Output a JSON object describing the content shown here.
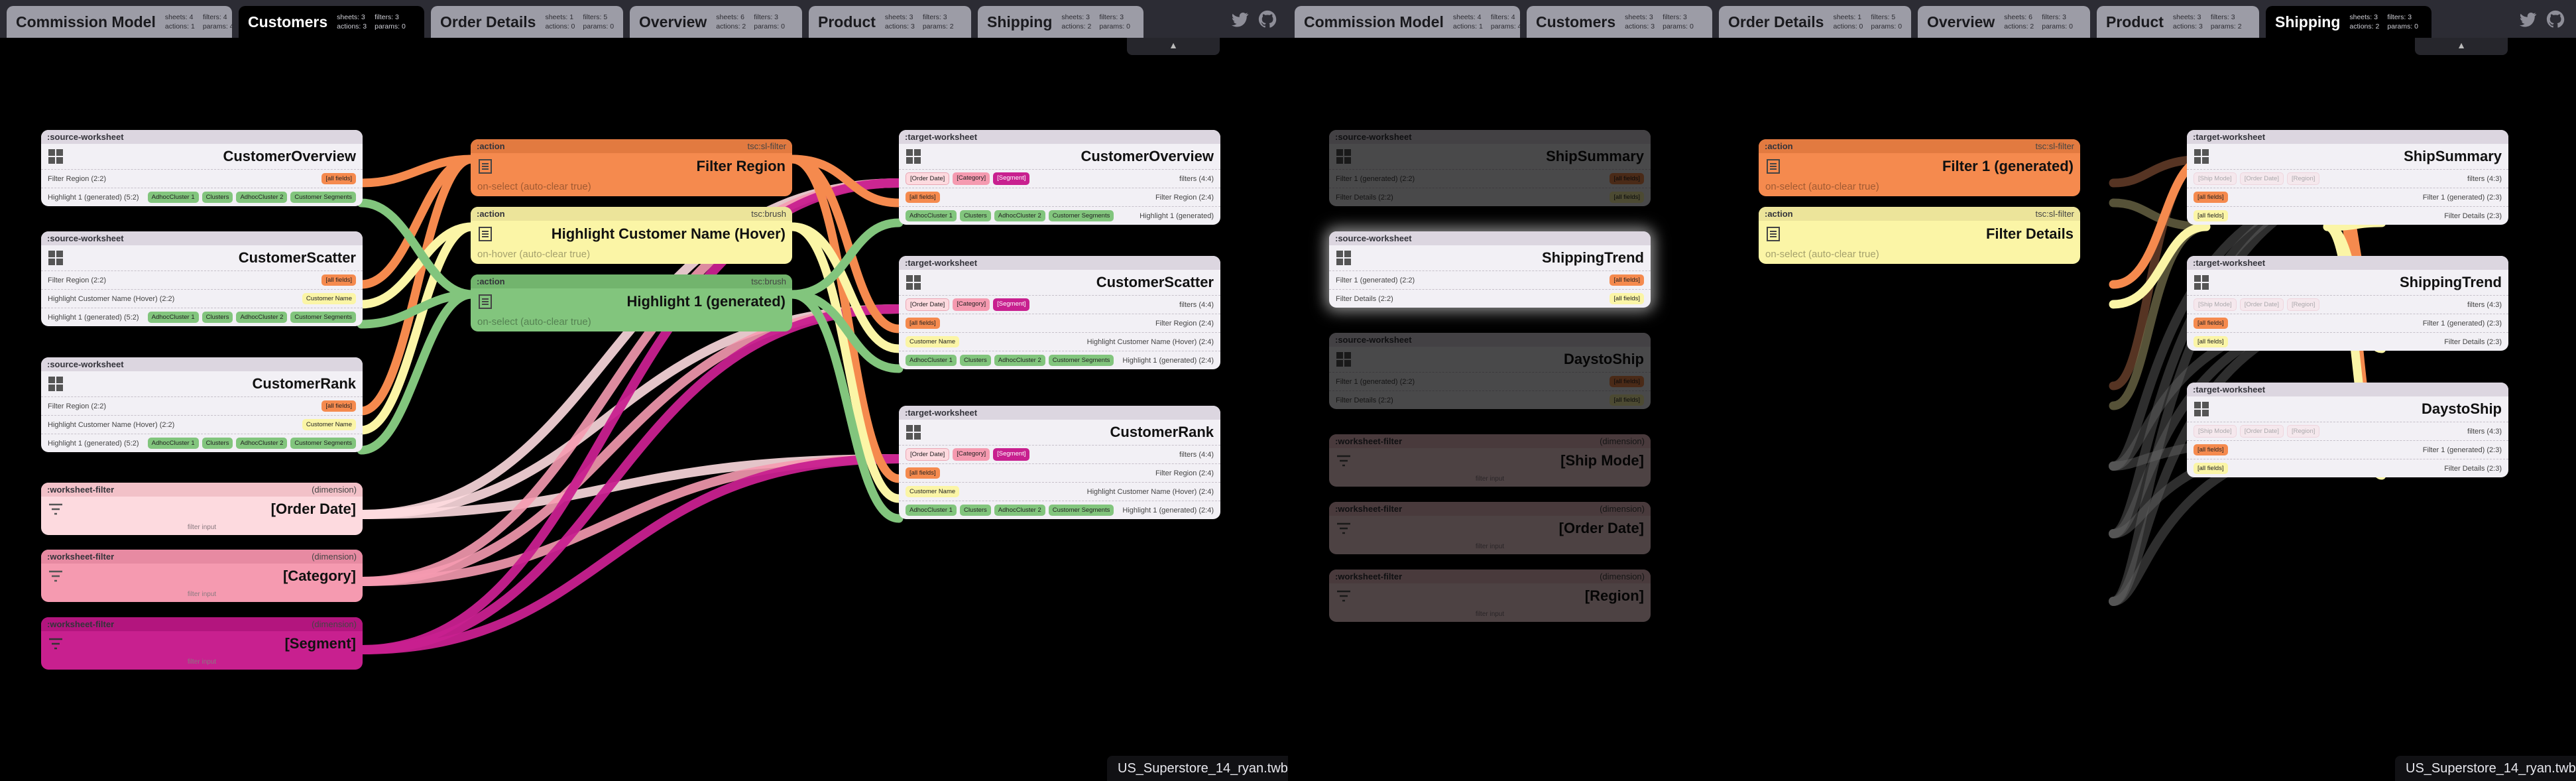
{
  "workbook": "US_Superstore_14_ryan.twb",
  "colors": {
    "orange": "#f58a4e",
    "yellow": "#fbf5a6",
    "green": "#82c57d",
    "pink": "#fddadf",
    "rose": "#f59ab0",
    "magenta": "#c8208f",
    "tabbar": "#2c2c34"
  },
  "icons": {
    "twitter": "twitter-icon",
    "github": "github-icon",
    "collapse": "caret-up-icon",
    "worksheet": "worksheet-grid-icon",
    "filter": "filter-lines-icon"
  },
  "tabs": [
    {
      "name": "Commission Model",
      "sheets": "sheets: 4",
      "filters": "filters: 4",
      "actions": "actions: 1",
      "params": "params: 4"
    },
    {
      "name": "Customers",
      "sheets": "sheets: 3",
      "filters": "filters: 3",
      "actions": "actions: 3",
      "params": "params: 0"
    },
    {
      "name": "Order Details",
      "sheets": "sheets: 1",
      "filters": "filters: 5",
      "actions": "actions: 0",
      "params": "params: 0"
    },
    {
      "name": "Overview",
      "sheets": "sheets: 6",
      "filters": "filters: 3",
      "actions": "actions: 2",
      "params": "params: 0"
    },
    {
      "name": "Product",
      "sheets": "sheets: 3",
      "filters": "filters: 3",
      "actions": "actions: 3",
      "params": "params: 2"
    },
    {
      "name": "Shipping",
      "sheets": "sheets: 3",
      "filters": "filters: 3",
      "actions": "actions: 2",
      "params": "params: 0"
    }
  ],
  "labels": {
    "source_ws": ":source-worksheet",
    "target_ws": ":target-worksheet",
    "action": ":action",
    "ws_filter": ":worksheet-filter",
    "dimension": "(dimension)",
    "filter_input": "filter input",
    "tsc_filter": "tsc:sl-filter",
    "tsc_brush": "tsc:brush",
    "all_fields": "[all fields]"
  },
  "left": {
    "sources": [
      {
        "title": "CustomerOverview",
        "rows": [
          {
            "name": "Filter Region (2:2)",
            "chips": [
              {
                "t": "[all fields]",
                "c": "orange"
              }
            ]
          },
          {
            "name": "Highlight 1 (generated) (5:2)",
            "chips": [
              {
                "t": "AdhocCluster 1",
                "c": "green"
              },
              {
                "t": "Clusters",
                "c": "green"
              },
              {
                "t": "AdhocCluster 2",
                "c": "green"
              },
              {
                "t": "Customer Segments",
                "c": "green"
              }
            ]
          }
        ]
      },
      {
        "title": "CustomerScatter",
        "rows": [
          {
            "name": "Filter Region (2:2)",
            "chips": [
              {
                "t": "[all fields]",
                "c": "orange"
              }
            ]
          },
          {
            "name": "Highlight Customer Name (Hover) (2:2)",
            "chips": [
              {
                "t": "Customer Name",
                "c": "yellow"
              }
            ]
          },
          {
            "name": "Highlight 1 (generated) (5:2)",
            "chips": [
              {
                "t": "AdhocCluster 1",
                "c": "green"
              },
              {
                "t": "Clusters",
                "c": "green"
              },
              {
                "t": "AdhocCluster 2",
                "c": "green"
              },
              {
                "t": "Customer Segments",
                "c": "green"
              }
            ]
          }
        ]
      },
      {
        "title": "CustomerRank",
        "rows": [
          {
            "name": "Filter Region (2:2)",
            "chips": [
              {
                "t": "[all fields]",
                "c": "orange"
              }
            ]
          },
          {
            "name": "Highlight Customer Name (Hover) (2:2)",
            "chips": [
              {
                "t": "Customer Name",
                "c": "yellow"
              }
            ]
          },
          {
            "name": "Highlight 1 (generated) (5:2)",
            "chips": [
              {
                "t": "AdhocCluster 1",
                "c": "green"
              },
              {
                "t": "Clusters",
                "c": "green"
              },
              {
                "t": "AdhocCluster 2",
                "c": "green"
              },
              {
                "t": "Customer Segments",
                "c": "green"
              }
            ]
          }
        ]
      }
    ],
    "filters": [
      {
        "title": "[Order Date]"
      },
      {
        "title": "[Category]"
      },
      {
        "title": "[Segment]"
      }
    ],
    "actions": [
      {
        "title": "Filter Region",
        "sub": "on-select (auto-clear true)",
        "type": "tsc:sl-filter"
      },
      {
        "title": "Highlight Customer Name (Hover)",
        "sub": "on-hover (auto-clear true)",
        "type": "tsc:brush"
      },
      {
        "title": "Highlight 1 (generated)",
        "sub": "on-select (auto-clear true)",
        "type": "tsc:brush"
      }
    ],
    "targets": [
      {
        "title": "CustomerOverview",
        "rows": [
          {
            "name": "filters (4:4)",
            "chips": [
              {
                "t": "[Order Date]",
                "c": "pink"
              },
              {
                "t": "[Category]",
                "c": "rose"
              },
              {
                "t": "[Segment]",
                "c": "magenta"
              }
            ]
          },
          {
            "name": "Filter Region (2:4)",
            "chips": [
              {
                "t": "[all fields]",
                "c": "orange"
              }
            ]
          },
          {
            "name": "Highlight 1 (generated)",
            "chips": [
              {
                "t": "AdhocCluster 1",
                "c": "green"
              },
              {
                "t": "Clusters",
                "c": "green"
              },
              {
                "t": "AdhocCluster 2",
                "c": "green"
              },
              {
                "t": "Customer Segments",
                "c": "green"
              }
            ]
          }
        ]
      },
      {
        "title": "CustomerScatter",
        "rows": [
          {
            "name": "filters (4:4)",
            "chips": [
              {
                "t": "[Order Date]",
                "c": "pink"
              },
              {
                "t": "[Category]",
                "c": "rose"
              },
              {
                "t": "[Segment]",
                "c": "magenta"
              }
            ]
          },
          {
            "name": "Filter Region (2:4)",
            "chips": [
              {
                "t": "[all fields]",
                "c": "orange"
              }
            ]
          },
          {
            "name": "Highlight Customer Name (Hover) (2:4)",
            "chips": [
              {
                "t": "Customer Name",
                "c": "yellow"
              }
            ]
          },
          {
            "name": "Highlight 1 (generated) (2:4)",
            "chips": [
              {
                "t": "AdhocCluster 1",
                "c": "green"
              },
              {
                "t": "Clusters",
                "c": "green"
              },
              {
                "t": "AdhocCluster 2",
                "c": "green"
              },
              {
                "t": "Customer Segments",
                "c": "green"
              }
            ]
          }
        ]
      },
      {
        "title": "CustomerRank",
        "rows": [
          {
            "name": "filters (4:4)",
            "chips": [
              {
                "t": "[Order Date]",
                "c": "pink"
              },
              {
                "t": "[Category]",
                "c": "rose"
              },
              {
                "t": "[Segment]",
                "c": "magenta"
              }
            ]
          },
          {
            "name": "Filter Region (2:4)",
            "chips": [
              {
                "t": "[all fields]",
                "c": "orange"
              }
            ]
          },
          {
            "name": "Highlight Customer Name (Hover) (2:4)",
            "chips": [
              {
                "t": "Customer Name",
                "c": "yellow"
              }
            ]
          },
          {
            "name": "Highlight 1 (generated) (2:4)",
            "chips": [
              {
                "t": "AdhocCluster 1",
                "c": "green"
              },
              {
                "t": "Clusters",
                "c": "green"
              },
              {
                "t": "AdhocCluster 2",
                "c": "green"
              },
              {
                "t": "Customer Segments",
                "c": "green"
              }
            ]
          }
        ]
      }
    ]
  },
  "right": {
    "sources": [
      {
        "title": "ShipSummary",
        "rows": [
          {
            "name": "Filter 1 (generated) (2:2)",
            "chips": [
              {
                "t": "[all fields]",
                "c": "orange"
              }
            ]
          },
          {
            "name": "Filter Details (2:2)",
            "chips": [
              {
                "t": "[all fields]",
                "c": "yellow"
              }
            ]
          }
        ]
      },
      {
        "title": "ShippingTrend",
        "rows": [
          {
            "name": "Filter 1 (generated) (2:2)",
            "chips": [
              {
                "t": "[all fields]",
                "c": "orange"
              }
            ]
          },
          {
            "name": "Filter Details (2:2)",
            "chips": [
              {
                "t": "[all fields]",
                "c": "yellow"
              }
            ]
          }
        ]
      },
      {
        "title": "DaystoShip",
        "rows": [
          {
            "name": "Filter 1 (generated) (2:2)",
            "chips": [
              {
                "t": "[all fields]",
                "c": "orange"
              }
            ]
          },
          {
            "name": "Filter Details (2:2)",
            "chips": [
              {
                "t": "[all fields]",
                "c": "yellow"
              }
            ]
          }
        ]
      }
    ],
    "filters": [
      {
        "title": "[Ship Mode]"
      },
      {
        "title": "[Order Date]"
      },
      {
        "title": "[Region]"
      }
    ],
    "actions": [
      {
        "title": "Filter 1 (generated)",
        "sub": "on-select (auto-clear true)",
        "type": "tsc:sl-filter"
      },
      {
        "title": "Filter Details",
        "sub": "on-select (auto-clear true)",
        "type": "tsc:sl-filter"
      }
    ],
    "targets": [
      {
        "title": "ShipSummary",
        "rows": [
          {
            "name": "filters (4:3)",
            "chips": [
              {
                "t": "[Ship Mode]",
                "c": "pink"
              },
              {
                "t": "[Order Date]",
                "c": "pink"
              },
              {
                "t": "[Region]",
                "c": "pink"
              }
            ]
          },
          {
            "name": "Filter 1 (generated) (2:3)",
            "chips": [
              {
                "t": "[all fields]",
                "c": "orange"
              }
            ]
          },
          {
            "name": "Filter Details (2:3)",
            "chips": [
              {
                "t": "[all fields]",
                "c": "yellow"
              }
            ]
          }
        ]
      },
      {
        "title": "ShippingTrend",
        "rows": [
          {
            "name": "filters (4:3)",
            "chips": [
              {
                "t": "[Ship Mode]",
                "c": "pink"
              },
              {
                "t": "[Order Date]",
                "c": "pink"
              },
              {
                "t": "[Region]",
                "c": "pink"
              }
            ]
          },
          {
            "name": "Filter 1 (generated) (2:3)",
            "chips": [
              {
                "t": "[all fields]",
                "c": "orange"
              }
            ]
          },
          {
            "name": "Filter Details (2:3)",
            "chips": [
              {
                "t": "[all fields]",
                "c": "yellow"
              }
            ]
          }
        ]
      },
      {
        "title": "DaystoShip",
        "rows": [
          {
            "name": "filters (4:3)",
            "chips": [
              {
                "t": "[Ship Mode]",
                "c": "pink"
              },
              {
                "t": "[Order Date]",
                "c": "pink"
              },
              {
                "t": "[Region]",
                "c": "pink"
              }
            ]
          },
          {
            "name": "Filter 1 (generated) (2:3)",
            "chips": [
              {
                "t": "[all fields]",
                "c": "orange"
              }
            ]
          },
          {
            "name": "Filter Details (2:3)",
            "chips": [
              {
                "t": "[all fields]",
                "c": "yellow"
              }
            ]
          }
        ]
      }
    ]
  }
}
